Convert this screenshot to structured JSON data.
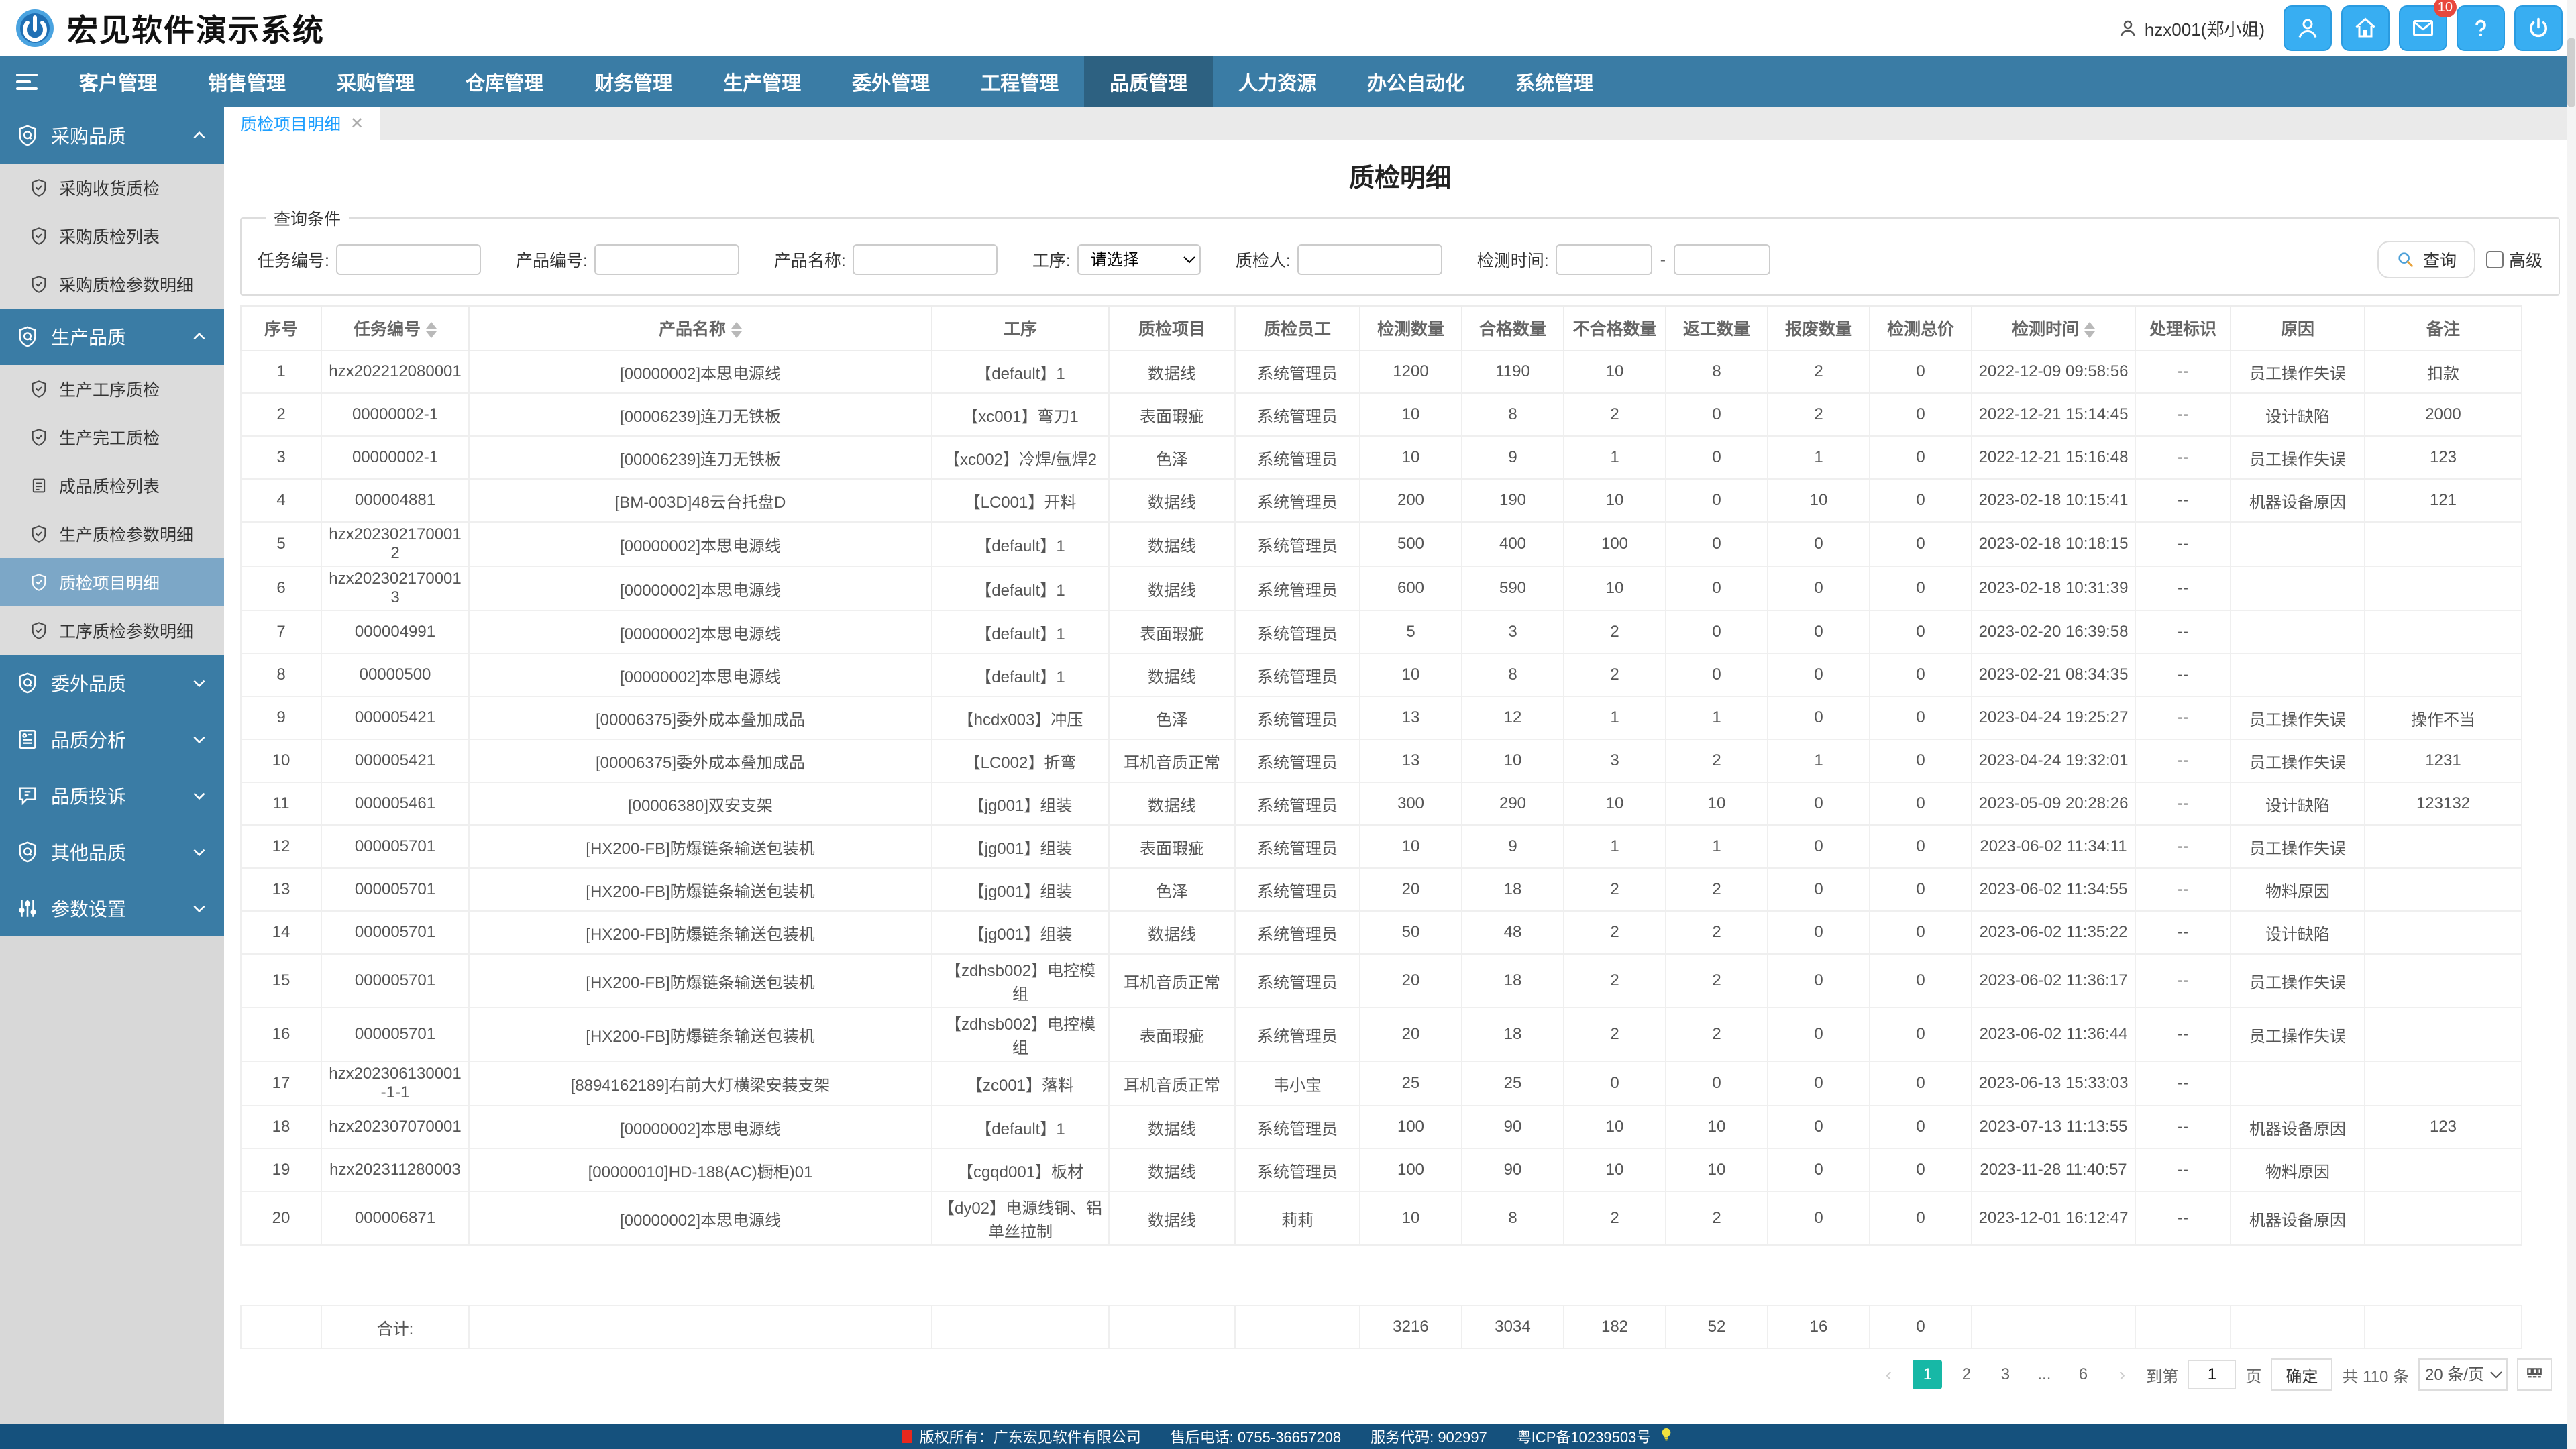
{
  "header": {
    "logo_text": "宏见软件演示系统",
    "user": "hzx001(郑小姐)",
    "mail_badge": "10",
    "buttons": [
      "avatar-icon",
      "home-icon",
      "mail-icon",
      "help-icon",
      "power-icon"
    ]
  },
  "nav": {
    "items": [
      "客户管理",
      "销售管理",
      "采购管理",
      "仓库管理",
      "财务管理",
      "生产管理",
      "委外管理",
      "工程管理",
      "品质管理",
      "人力资源",
      "办公自动化",
      "系统管理"
    ],
    "active": "品质管理"
  },
  "sidebar": {
    "groups": [
      {
        "label": "采购品质",
        "icon": "shield-q-icon",
        "state": "expanded",
        "items": [
          {
            "label": "采购收货质检",
            "icon": "shield-check-icon",
            "active": false
          },
          {
            "label": "采购质检列表",
            "icon": "shield-check-icon",
            "active": false
          },
          {
            "label": "采购质检参数明细",
            "icon": "shield-check-icon",
            "active": false
          }
        ]
      },
      {
        "label": "生产品质",
        "icon": "shield-q-icon",
        "state": "expanded",
        "items": [
          {
            "label": "生产工序质检",
            "icon": "shield-check-icon",
            "active": false
          },
          {
            "label": "生产完工质检",
            "icon": "shield-check-icon",
            "active": false
          },
          {
            "label": "成品质检列表",
            "icon": "list-icon",
            "active": false
          },
          {
            "label": "生产质检参数明细",
            "icon": "shield-check-icon",
            "active": false
          },
          {
            "label": "质检项目明细",
            "icon": "shield-check-icon",
            "active": true
          },
          {
            "label": "工序质检参数明细",
            "icon": "shield-check-icon",
            "active": false
          }
        ]
      },
      {
        "label": "委外品质",
        "icon": "shield-q-icon",
        "state": "collapsed",
        "items": []
      },
      {
        "label": "品质分析",
        "icon": "report-icon",
        "state": "collapsed",
        "items": []
      },
      {
        "label": "品质投诉",
        "icon": "chat-icon",
        "state": "collapsed",
        "items": []
      },
      {
        "label": "其他品质",
        "icon": "shield-q-icon",
        "state": "collapsed",
        "items": []
      },
      {
        "label": "参数设置",
        "icon": "sliders-icon",
        "state": "collapsed",
        "items": []
      }
    ]
  },
  "tabs": {
    "items": [
      {
        "label": "质检项目明细",
        "active": true
      }
    ]
  },
  "page": {
    "title": "质检明细"
  },
  "query": {
    "legend": "查询条件",
    "task_label": "任务编号:",
    "product_no_label": "产品编号:",
    "product_name_label": "产品名称:",
    "process_label": "工序:",
    "process_selected": "请选择",
    "inspector_label": "质检人:",
    "time_label": "检测时间:",
    "range_separator": "-",
    "search_label": "查询",
    "advanced_label": "高级"
  },
  "table": {
    "columns": [
      {
        "label": "序号",
        "sortable": false
      },
      {
        "label": "任务编号",
        "sortable": true
      },
      {
        "label": "产品名称",
        "sortable": true
      },
      {
        "label": "工序",
        "sortable": false
      },
      {
        "label": "质检项目",
        "sortable": false
      },
      {
        "label": "质检员工",
        "sortable": false
      },
      {
        "label": "检测数量",
        "sortable": false
      },
      {
        "label": "合格数量",
        "sortable": false
      },
      {
        "label": "不合格数量",
        "sortable": false
      },
      {
        "label": "返工数量",
        "sortable": false
      },
      {
        "label": "报废数量",
        "sortable": false
      },
      {
        "label": "检测总价",
        "sortable": false
      },
      {
        "label": "检测时间",
        "sortable": true
      },
      {
        "label": "处理标识",
        "sortable": false
      },
      {
        "label": "原因",
        "sortable": false
      },
      {
        "label": "备注",
        "sortable": false
      }
    ],
    "rows": [
      [
        "1",
        "hzx202212080001",
        "[00000002]本思电源线",
        "【default】1",
        "数据线",
        "系统管理员",
        "1200",
        "1190",
        "10",
        "8",
        "2",
        "0",
        "2022-12-09 09:58:56",
        "--",
        "员工操作失误",
        "扣款"
      ],
      [
        "2",
        "00000002-1",
        "[00006239]连刀无铁板",
        "【xc001】弯刀1",
        "表面瑕疵",
        "系统管理员",
        "10",
        "8",
        "2",
        "0",
        "2",
        "0",
        "2022-12-21 15:14:45",
        "--",
        "设计缺陷",
        "2000"
      ],
      [
        "3",
        "00000002-1",
        "[00006239]连刀无铁板",
        "【xc002】冷焊/氩焊2",
        "色泽",
        "系统管理员",
        "10",
        "9",
        "1",
        "0",
        "1",
        "0",
        "2022-12-21 15:16:48",
        "--",
        "员工操作失误",
        "123"
      ],
      [
        "4",
        "000004881",
        "[BM-003D]48云台托盘D",
        "【LC001】开料",
        "数据线",
        "系统管理员",
        "200",
        "190",
        "10",
        "0",
        "10",
        "0",
        "2023-02-18 10:15:41",
        "--",
        "机器设备原因",
        "121"
      ],
      [
        "5",
        "hzx2023021700012",
        "[00000002]本思电源线",
        "【default】1",
        "数据线",
        "系统管理员",
        "500",
        "400",
        "100",
        "0",
        "0",
        "0",
        "2023-02-18 10:18:15",
        "--",
        "",
        ""
      ],
      [
        "6",
        "hzx2023021700013",
        "[00000002]本思电源线",
        "【default】1",
        "数据线",
        "系统管理员",
        "600",
        "590",
        "10",
        "0",
        "0",
        "0",
        "2023-02-18 10:31:39",
        "--",
        "",
        ""
      ],
      [
        "7",
        "000004991",
        "[00000002]本思电源线",
        "【default】1",
        "表面瑕疵",
        "系统管理员",
        "5",
        "3",
        "2",
        "0",
        "0",
        "0",
        "2023-02-20 16:39:58",
        "--",
        "",
        ""
      ],
      [
        "8",
        "00000500",
        "[00000002]本思电源线",
        "【default】1",
        "数据线",
        "系统管理员",
        "10",
        "8",
        "2",
        "0",
        "0",
        "0",
        "2023-02-21 08:34:35",
        "--",
        "",
        ""
      ],
      [
        "9",
        "000005421",
        "[00006375]委外成本叠加成品",
        "【hcdx003】冲压",
        "色泽",
        "系统管理员",
        "13",
        "12",
        "1",
        "1",
        "0",
        "0",
        "2023-04-24 19:25:27",
        "--",
        "员工操作失误",
        "操作不当"
      ],
      [
        "10",
        "000005421",
        "[00006375]委外成本叠加成品",
        "【LC002】折弯",
        "耳机音质正常",
        "系统管理员",
        "13",
        "10",
        "3",
        "2",
        "1",
        "0",
        "2023-04-24 19:32:01",
        "--",
        "员工操作失误",
        "1231"
      ],
      [
        "11",
        "000005461",
        "[00006380]双安支架",
        "【jg001】组装",
        "数据线",
        "系统管理员",
        "300",
        "290",
        "10",
        "10",
        "0",
        "0",
        "2023-05-09 20:28:26",
        "--",
        "设计缺陷",
        "123132"
      ],
      [
        "12",
        "000005701",
        "[HX200-FB]防爆链条输送包装机",
        "【jg001】组装",
        "表面瑕疵",
        "系统管理员",
        "10",
        "9",
        "1",
        "1",
        "0",
        "0",
        "2023-06-02 11:34:11",
        "--",
        "员工操作失误",
        ""
      ],
      [
        "13",
        "000005701",
        "[HX200-FB]防爆链条输送包装机",
        "【jg001】组装",
        "色泽",
        "系统管理员",
        "20",
        "18",
        "2",
        "2",
        "0",
        "0",
        "2023-06-02 11:34:55",
        "--",
        "物料原因",
        ""
      ],
      [
        "14",
        "000005701",
        "[HX200-FB]防爆链条输送包装机",
        "【jg001】组装",
        "数据线",
        "系统管理员",
        "50",
        "48",
        "2",
        "2",
        "0",
        "0",
        "2023-06-02 11:35:22",
        "--",
        "设计缺陷",
        ""
      ],
      [
        "15",
        "000005701",
        "[HX200-FB]防爆链条输送包装机",
        "【zdhsb002】电控模组",
        "耳机音质正常",
        "系统管理员",
        "20",
        "18",
        "2",
        "2",
        "0",
        "0",
        "2023-06-02 11:36:17",
        "--",
        "员工操作失误",
        ""
      ],
      [
        "16",
        "000005701",
        "[HX200-FB]防爆链条输送包装机",
        "【zdhsb002】电控模组",
        "表面瑕疵",
        "系统管理员",
        "20",
        "18",
        "2",
        "2",
        "0",
        "0",
        "2023-06-02 11:36:44",
        "--",
        "员工操作失误",
        ""
      ],
      [
        "17",
        "hzx202306130001-1-1",
        "[8894162189]右前大灯横梁安装支架",
        "【zc001】落料",
        "耳机音质正常",
        "韦小宝",
        "25",
        "25",
        "0",
        "0",
        "0",
        "0",
        "2023-06-13 15:33:03",
        "--",
        "",
        ""
      ],
      [
        "18",
        "hzx202307070001",
        "[00000002]本思电源线",
        "【default】1",
        "数据线",
        "系统管理员",
        "100",
        "90",
        "10",
        "10",
        "0",
        "0",
        "2023-07-13 11:13:55",
        "--",
        "机器设备原因",
        "123"
      ],
      [
        "19",
        "hzx202311280003",
        "[00000010]HD-188(AC)橱柜)01",
        "【cgqd001】板材",
        "数据线",
        "系统管理员",
        "100",
        "90",
        "10",
        "10",
        "0",
        "0",
        "2023-11-28 11:40:57",
        "--",
        "物料原因",
        ""
      ],
      [
        "20",
        "000006871",
        "[00000002]本思电源线",
        "【dy02】电源线铜、铝单丝拉制",
        "数据线",
        "莉莉",
        "10",
        "8",
        "2",
        "2",
        "0",
        "0",
        "2023-12-01 16:12:47",
        "--",
        "机器设备原因",
        ""
      ]
    ],
    "totals_row": [
      "",
      "合计:",
      "",
      "",
      "",
      "",
      "3216",
      "3034",
      "182",
      "52",
      "16",
      "0",
      "",
      "",
      "",
      ""
    ]
  },
  "pagination": {
    "prev": "‹",
    "pages": [
      "1",
      "2",
      "3",
      "...",
      "6"
    ],
    "active": "1",
    "next": "›",
    "goto_prefix": "到第",
    "goto_value": "1",
    "goto_suffix": "页",
    "confirm_label": "确定",
    "total_label": "共 110 条",
    "page_size": "20 条/页"
  },
  "footer": {
    "copyright": "版权所有：广东宏见软件有限公司",
    "phone": "售后电话: 0755-36657208",
    "service_code": "服务代码: 902997",
    "icp": "粤ICP备10239503号"
  }
}
